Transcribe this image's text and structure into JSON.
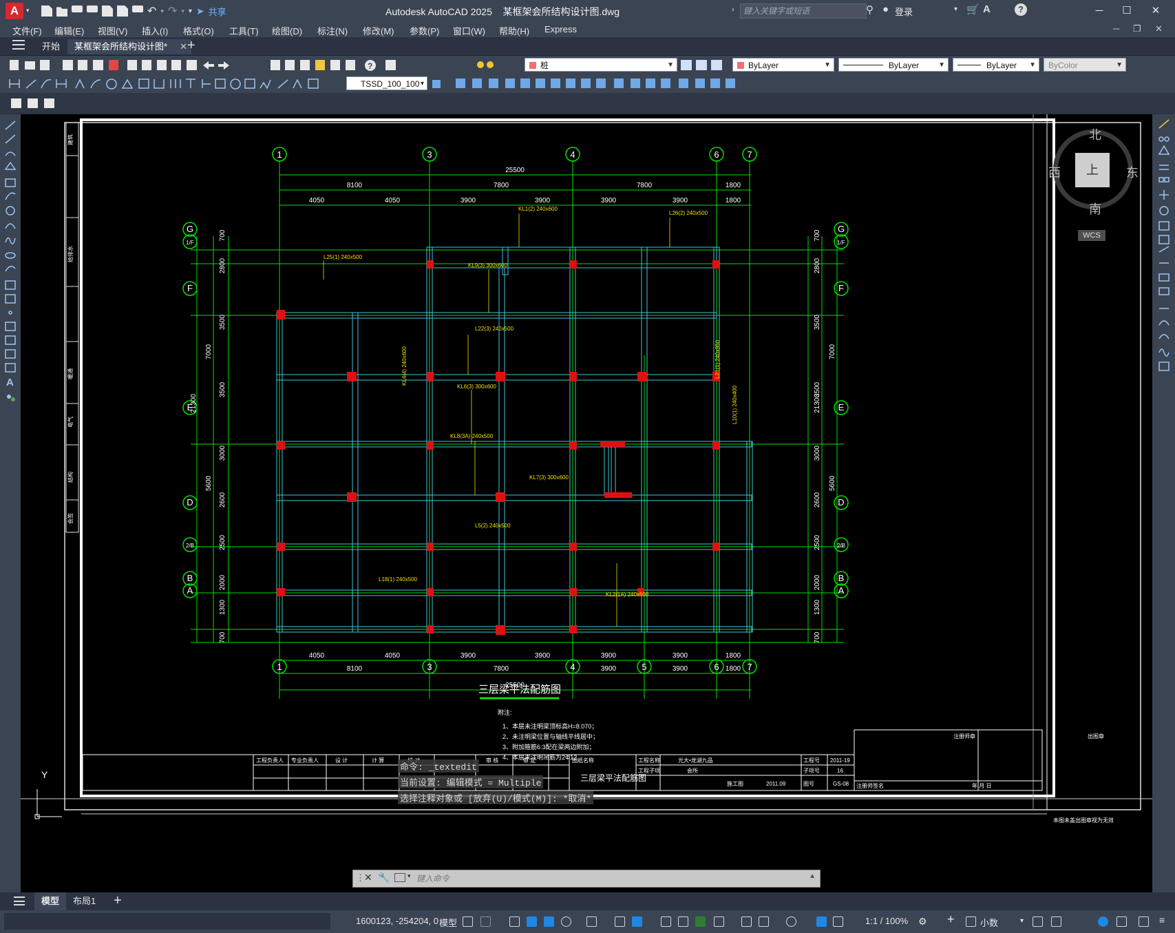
{
  "app": {
    "title": "Autodesk AutoCAD 2025",
    "filename": "某框架会所结构设计图.dwg",
    "logo_letter": "A",
    "share_label": "共享",
    "search_placeholder": "键入关键字或短语",
    "login_label": "登录"
  },
  "menu": [
    "文件(F)",
    "编辑(E)",
    "视图(V)",
    "插入(I)",
    "格式(O)",
    "工具(T)",
    "绘图(D)",
    "标注(N)",
    "修改(M)",
    "参数(P)",
    "窗口(W)",
    "帮助(H)",
    "Express"
  ],
  "tabs": {
    "start": "开始",
    "document": "某框架会所结构设计图*"
  },
  "properties": {
    "layer": "桩",
    "color": "ByLayer",
    "linetype": "ByLayer",
    "lineweight": "ByLayer",
    "plotstyle": "ByColor",
    "dimstyle": "TSSD_100_100"
  },
  "viewcube": {
    "north": "北",
    "south": "南",
    "east": "东",
    "west": "西",
    "face": "上",
    "wcs": "WCS"
  },
  "drawing": {
    "grid_top": [
      "1",
      "3",
      "4",
      "6",
      "7"
    ],
    "grid_bottom": [
      "1",
      "3",
      "4",
      "5",
      "6",
      "7"
    ],
    "grid_rows": [
      "G",
      "1/F",
      "F",
      "E",
      "D",
      "2/B",
      "B",
      "A"
    ],
    "top_dims_row1": [
      "25500"
    ],
    "top_dims_row2": [
      "8100",
      "7800",
      "7800",
      "1800"
    ],
    "top_dims_row3": [
      "4050",
      "4050",
      "3900",
      "3900",
      "3900",
      "3900",
      "1800"
    ],
    "bottom_dims_row1": [
      "4050",
      "4050",
      "3900",
      "3900",
      "3900",
      "3900",
      "1800"
    ],
    "bottom_dims_row2": [
      "8100",
      "7800",
      "3900",
      "3900",
      "1800"
    ],
    "bottom_dims_row3": [
      "25500"
    ],
    "left_dims": [
      "700",
      "2800",
      "3500",
      "3500",
      "3000",
      "2600",
      "2500",
      "2000",
      "1300",
      "700"
    ],
    "left_dims_outer": [
      "7000",
      "5600",
      "21300"
    ],
    "beam_labels": [
      "KL1(2) 240x600",
      "L26(2) 240x500",
      "L25(1) 240x500",
      "KL9(3) 300x600",
      "L22(3) 240x500",
      "KL4(4) 240x600",
      "KL6(3) 300x600",
      "KL7(3) 300x600",
      "L5(2) 240x500",
      "KL8(3A) 240x500",
      "L18(1) 240x500",
      "KL2(1A) 240x600",
      "L21(1) 240x950",
      "L10(1) 240x400"
    ],
    "title": "三层梁平法配筋图",
    "notes_title": "附注:",
    "notes": [
      "1、本层未注明梁顶标高H=8.070；",
      "2、未注明梁位置与轴线平线居中；",
      "3、附加箍筋6:3配在梁两边附加；",
      "4、本层未注明吊筋为2Φ12"
    ],
    "titleblock": {
      "sheet_name_label": "图纸名称",
      "sheet_name": "三层梁平法配筋图",
      "project_label": "工程名称",
      "project": "光大•龙湖九品",
      "item_label": "工程子项",
      "item": "会所",
      "proj_no_label": "工程号",
      "proj_no": "2011-19",
      "sub_no_label": "子项号",
      "sub_no": "16",
      "drawing_no_label": "图号",
      "drawing_no": "GS-08",
      "date": "2011.09",
      "signers": [
        "工程负责人",
        "专业负责人",
        "设 计",
        "计 算",
        "校 对",
        "审 核",
        "审 定"
      ],
      "stage_label": "施工图",
      "registry": "注册师章",
      "seal": "出图章",
      "reg_sign": "注册师签名",
      "ymd": "年 月 日",
      "footer_note": "本图未盖出图章视为无效"
    },
    "side_strip": [
      "会签",
      "结构",
      "电气",
      "暖通",
      "给排水",
      "建筑"
    ]
  },
  "command": {
    "history": [
      "命令: _textedit",
      "当前设置: 编辑模式 = Multiple",
      "选择注释对象或 [放弃(U)/模式(M)]: *取消*"
    ],
    "placeholder": "键入命令"
  },
  "layout_tabs": [
    "模型",
    "布局1"
  ],
  "status": {
    "coords": "1600123, -254204, 0",
    "space": "模型",
    "scale": "1:1 / 100%",
    "units": "小数"
  }
}
